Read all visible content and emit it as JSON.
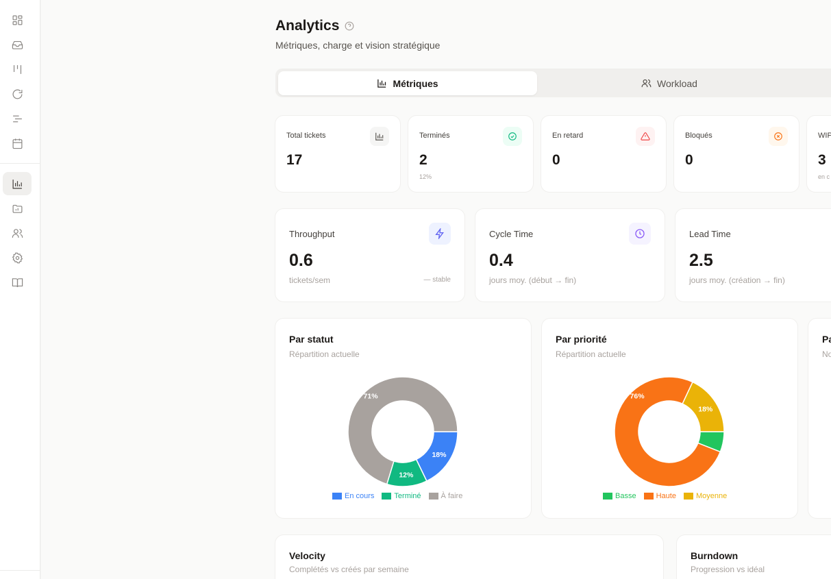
{
  "header": {
    "title": "Analytics",
    "subtitle": "Métriques, charge et vision stratégique"
  },
  "sidebar": {
    "items": [
      {
        "name": "dashboard",
        "icon": "grid-icon",
        "active": false
      },
      {
        "name": "inbox",
        "icon": "inbox-icon",
        "active": false
      },
      {
        "name": "board",
        "icon": "kanban-icon",
        "active": false
      },
      {
        "name": "cycles",
        "icon": "refresh-icon",
        "active": false
      },
      {
        "name": "timeline",
        "icon": "list-icon",
        "active": false
      },
      {
        "name": "calendar",
        "icon": "calendar-icon",
        "active": false
      },
      {
        "name": "analytics",
        "icon": "bar-chart-icon",
        "active": true
      },
      {
        "name": "reports",
        "icon": "folder-chart-icon",
        "active": false
      },
      {
        "name": "team",
        "icon": "users-icon",
        "active": false
      },
      {
        "name": "settings",
        "icon": "gear-icon",
        "active": false
      },
      {
        "name": "docs",
        "icon": "book-icon",
        "active": false
      }
    ]
  },
  "tabs": [
    {
      "label": "Métriques",
      "icon": "bar-chart-icon",
      "active": true
    },
    {
      "label": "Workload",
      "icon": "users-icon",
      "active": false
    }
  ],
  "stats": [
    {
      "label": "Total tickets",
      "value": "17",
      "sub": "",
      "icon": "bar-chart-icon",
      "color": "#57534e",
      "bg": "#f5f5f4"
    },
    {
      "label": "Terminés",
      "value": "2",
      "sub": "12%",
      "icon": "check-circle-icon",
      "color": "#10b981",
      "bg": "#ecfdf5"
    },
    {
      "label": "En retard",
      "value": "0",
      "sub": "",
      "icon": "alert-triangle-icon",
      "color": "#ef4444",
      "bg": "#fef2f2"
    },
    {
      "label": "Bloqués",
      "value": "0",
      "sub": "",
      "icon": "x-circle-icon",
      "color": "#f97316",
      "bg": "#fff7ed"
    },
    {
      "label": "WIP",
      "value": "3",
      "sub": "en c",
      "icon": "",
      "color": "#57534e",
      "bg": "#f5f5f4"
    }
  ],
  "flow": [
    {
      "label": "Throughput",
      "value": "0.6",
      "sub": "tickets/sem",
      "trend": "— stable",
      "icon": "lightning-icon",
      "color": "#6366f1",
      "bg": "#eef2ff"
    },
    {
      "label": "Cycle Time",
      "value": "0.4",
      "sub": "jours moy. (début → fin)",
      "trend": "",
      "icon": "clock-icon",
      "color": "#8b5cf6",
      "bg": "#f5f3ff"
    },
    {
      "label": "Lead Time",
      "value": "2.5",
      "sub": "jours moy. (création → fin)",
      "trend": "",
      "icon": "",
      "color": "#10b981",
      "bg": "#ecfdf5"
    }
  ],
  "chart_data": [
    {
      "type": "pie",
      "title": "Par statut",
      "subtitle": "Répartition actuelle",
      "legend_position": "bottom",
      "slices": [
        {
          "label": "En cours",
          "value": 18,
          "color": "#3b82f6"
        },
        {
          "label": "Terminé",
          "value": 12,
          "color": "#10b981"
        },
        {
          "label": "À faire",
          "value": 71,
          "color": "#a8a29e"
        }
      ]
    },
    {
      "type": "pie",
      "title": "Par priorité",
      "subtitle": "Répartition actuelle",
      "legend_position": "bottom",
      "slices": [
        {
          "label": "Basse",
          "value": 6,
          "color": "#22c55e",
          "show_label": false
        },
        {
          "label": "Haute",
          "value": 76,
          "color": "#f97316"
        },
        {
          "label": "Moyenne",
          "value": 18,
          "color": "#eab308"
        }
      ]
    }
  ],
  "partial_cards": {
    "third_chart_title": "Pa",
    "third_chart_sub": "No"
  },
  "bottom": {
    "velocity_title": "Velocity",
    "velocity_sub": "Complétés vs créés par semaine",
    "burndown_title": "Burndown",
    "burndown_sub": "Progression vs idéal"
  }
}
